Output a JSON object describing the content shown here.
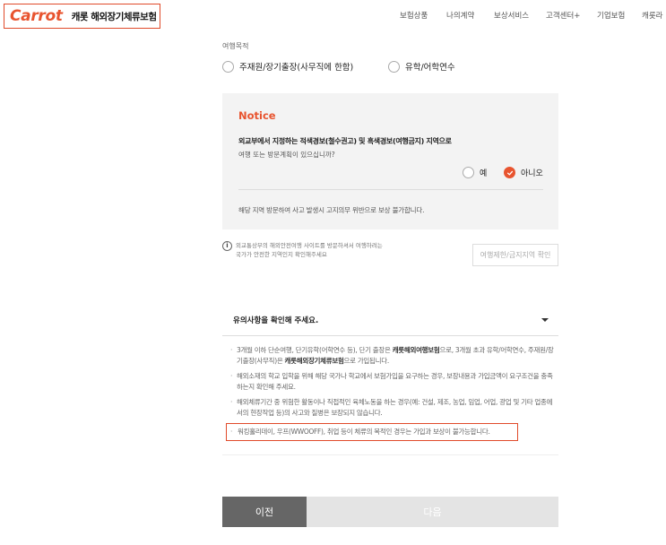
{
  "header": {
    "logo": "Carrot",
    "product_name": "캐롯 해외장기체류보험",
    "nav": [
      "보험상품",
      "나의계약",
      "보상서비스",
      "고객센터+",
      "기업보험",
      "캐롯라"
    ]
  },
  "travel_purpose": {
    "label": "여행목적",
    "options": [
      "주재원/장기출장(사무직에 한함)",
      "유학/어학연수"
    ]
  },
  "notice": {
    "title": "Notice",
    "question": "외교부에서 지정하는 적색경보(철수권고) 및 흑색경보(여행금지) 지역으로",
    "sub_question": "여행 또는 방문계획이 있으십니까?",
    "yes_label": "예",
    "no_label": "아니오",
    "selected": "아니오",
    "warning": "해당 지역 방문하여 사고 발생시 고지의무 위반으로 보상 불가합니다."
  },
  "info": {
    "icon": "info-icon",
    "line1": "외교통상부의 해외안전여행 사이트를 방문하셔서 여행하려는",
    "line2": "국가가 안전한 지역인지 확인해주세요",
    "button": "여행제한/금지지역 확인"
  },
  "cautions": {
    "heading": "유의사항을 확인해 주세요.",
    "item1_pre": "3개월 이하 단순여행, 단기유학(어학연수 등), 단기 출장은 ",
    "item1_b1": "캐롯해외여행보험",
    "item1_mid": "으로, 3개월 초과 유학/어학연수, 주재원/장기출장(사무직)은 ",
    "item1_b2": "캐롯해외장기체류보험",
    "item1_post": "으로 가입됩니다.",
    "item2": "해외소재의 학교 입학을 위해 해당 국가나 학교에서 보험가입을 요구하는 경우, 보장내용과 가입금액이 요구조건을 충족하는지 확인해 주세요.",
    "item3": "해외체류기간 중 위험한 활동이나 직접적인 육체노동을 하는 경우(예: 건설, 제조, 농업, 임업, 어업, 광업 및 기타 업종에서의 현장작업 등)의 사고와 질병은 보장되지 않습니다.",
    "item4": "워킹홀리데이, 우프(WWOOFF), 취업 등이 체류의 목적인 경우는 가입과 보상이 불가능합니다."
  },
  "buttons": {
    "prev": "이전",
    "next": "다음"
  },
  "colors": {
    "brand": "#e8542f",
    "highlight_border": "#e04a2a",
    "prev_button": "#666666",
    "next_button_disabled": "#e4e4e4"
  }
}
